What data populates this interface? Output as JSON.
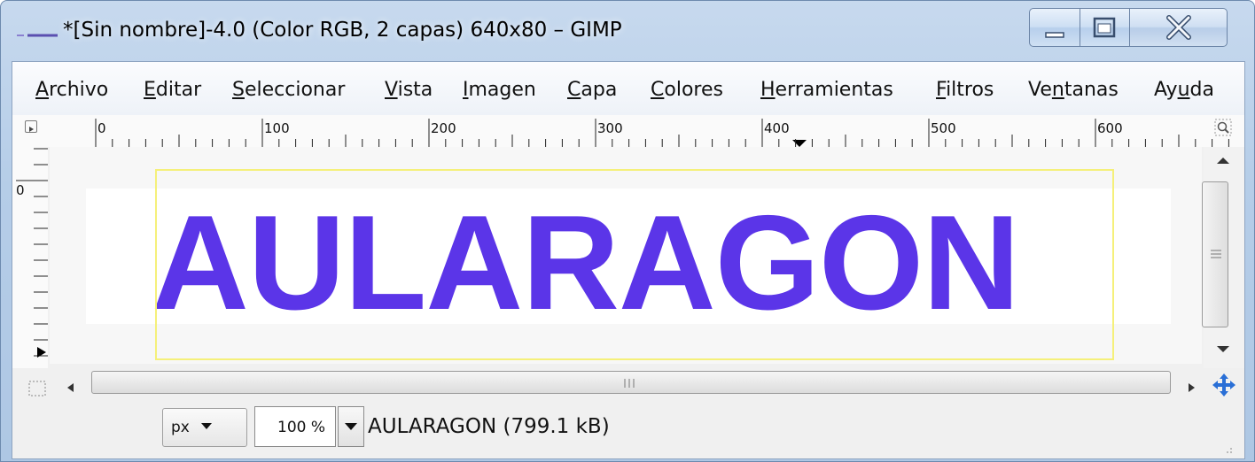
{
  "window": {
    "title": "*[Sin nombre]-4.0 (Color RGB, 2 capas) 640x80 – GIMP",
    "icon": "gimp-wilber-icon",
    "controls": [
      "minimize-icon",
      "maximize-icon",
      "close-icon"
    ]
  },
  "menubar": {
    "items": [
      {
        "label": "Archivo",
        "mnemonic": "A",
        "rest": "rchivo"
      },
      {
        "label": "Editar",
        "mnemonic": "E",
        "rest": "ditar"
      },
      {
        "label": "Seleccionar",
        "mnemonic": "S",
        "rest": "eleccionar"
      },
      {
        "label": "Vista",
        "mnemonic": "V",
        "rest": "ista"
      },
      {
        "label": "Imagen",
        "mnemonic": "I",
        "rest": "magen"
      },
      {
        "label": "Capa",
        "mnemonic": "C",
        "rest": "apa"
      },
      {
        "label": "Colores",
        "mnemonic": "C",
        "rest": "olores"
      },
      {
        "label": "Herramientas",
        "mnemonic": "H",
        "rest": "erramientas"
      },
      {
        "label": "Filtros",
        "mnemonic": "F",
        "rest": "iltros"
      },
      {
        "label": "Ventanas",
        "pre": "Ve",
        "mnemonic": "n",
        "rest": "tanas"
      },
      {
        "label": "Ayuda",
        "pre": "Ay",
        "mnemonic": "u",
        "rest": "da"
      }
    ]
  },
  "rulers": {
    "horizontal_labels": [
      "0",
      "100",
      "200",
      "300",
      "400",
      "500",
      "600"
    ],
    "vertical_labels": [
      "0"
    ]
  },
  "canvas": {
    "image_text": "AULARAGON",
    "text_color": "#5b35e8",
    "background_color": "#ffffff"
  },
  "statusbar": {
    "unit": "px",
    "zoom": "100 %",
    "info": "AULARAGON (799.1 kB)"
  },
  "icons": {
    "quick_mask": "quick-mask-icon",
    "zoom_fit": "zoom-image-icon",
    "navigate": "navigate-icon",
    "scroll_up": "arrow-up-icon",
    "scroll_down": "arrow-down-icon",
    "scroll_left": "arrow-left-icon",
    "scroll_right": "arrow-right-icon"
  }
}
